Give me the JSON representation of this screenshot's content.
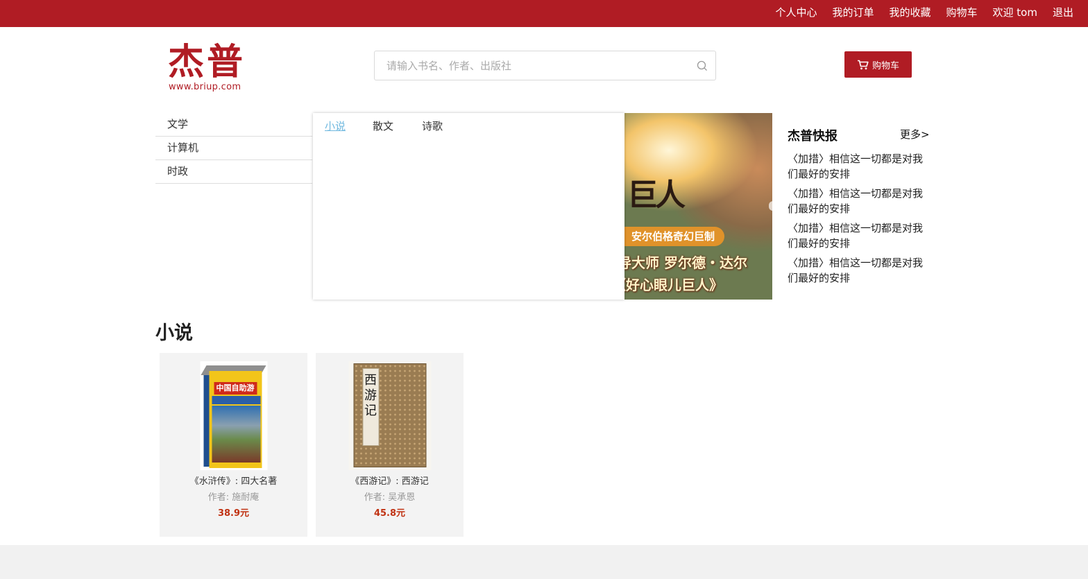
{
  "topnav": [
    "个人中心",
    "我的订单",
    "我的收藏",
    "购物车",
    "欢迎 tom",
    "退出"
  ],
  "logo": {
    "main": "杰普",
    "sub": "www.briup.com"
  },
  "search": {
    "placeholder": "请输入书名、作者、出版社",
    "value": ""
  },
  "cart_button": "购物车",
  "categories": [
    "文学",
    "计算机",
    "时政"
  ],
  "subcategories": [
    {
      "label": "小说",
      "active": true
    },
    {
      "label": "散文",
      "active": false
    },
    {
      "label": "诗歌",
      "active": false
    }
  ],
  "banner": {
    "line1": "巨人",
    "tag": "安尔伯格奇幻巨制",
    "line3": "导大师 罗尔德・达尔",
    "line4": "《好心眼儿巨人》"
  },
  "news": {
    "title": "杰普快报",
    "more": "更多>",
    "items": [
      "〈加措〉相信这一切都是对我们最好的安排",
      "〈加措〉相信这一切都是对我们最好的安排",
      "〈加措〉相信这一切都是对我们最好的安排",
      "〈加措〉相信这一切都是对我们最好的安排"
    ]
  },
  "section": {
    "title": "小说",
    "books": [
      {
        "name": "《水浒传》: 四大名著",
        "author": "作者: 施耐庵",
        "price": "38.9元",
        "cover_text": "中国自助游"
      },
      {
        "name": "《西游记》: 西游记",
        "author": "作者: 吴承恩",
        "price": "45.8元",
        "cover_text": "西游记"
      }
    ]
  },
  "colors": {
    "brand": "#b01c24",
    "link_active": "#6fb8df",
    "price": "#c03212"
  }
}
